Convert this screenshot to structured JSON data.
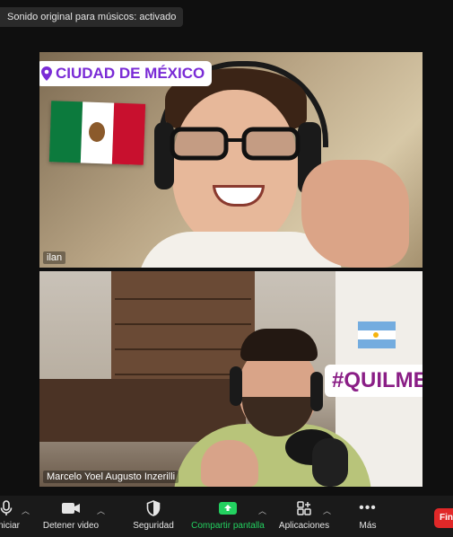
{
  "notice": "Sonido original para músicos: activado",
  "top_tile": {
    "participant_name": "ilan",
    "location_sticker": "CIUDAD DE MÉXICO"
  },
  "bottom_tile": {
    "participant_name": "Marcelo Yoel Augusto Inzerilli",
    "hashtag_sticker": "#QUILMES"
  },
  "toolbar": {
    "start_audio_label": "Iniciar",
    "stop_video_label": "Detener video",
    "security_label": "Seguridad",
    "share_screen_label": "Compartir pantalla",
    "apps_label": "Aplicaciones",
    "more_label": "Más",
    "finish_label": "Finalizar"
  },
  "colors": {
    "share_green": "#23d160",
    "finish_red": "#e02828",
    "sticker_purple": "#7a2bd6"
  }
}
